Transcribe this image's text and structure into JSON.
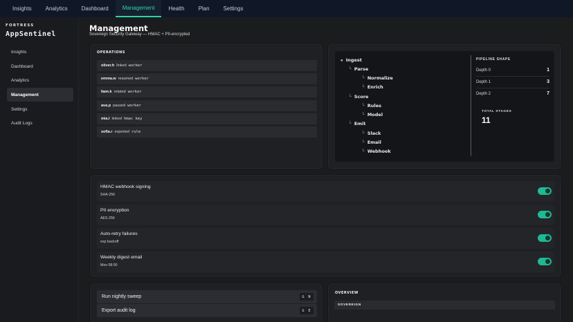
{
  "topnav": {
    "tabs": [
      {
        "label": "Insights"
      },
      {
        "label": "Analytics"
      },
      {
        "label": "Dashboard"
      },
      {
        "label": "Management"
      },
      {
        "label": "Health"
      },
      {
        "label": "Plan"
      },
      {
        "label": "Settings"
      }
    ],
    "active": "Management"
  },
  "sidebar": {
    "brand_kicker": "FORTRESS",
    "brand_name": "AppSentinel",
    "items": [
      {
        "label": "Insights"
      },
      {
        "label": "Dashboard"
      },
      {
        "label": "Analytics"
      },
      {
        "label": "Management"
      },
      {
        "label": "Settings"
      },
      {
        "label": "Audit Logs"
      }
    ],
    "active": "Management"
  },
  "page": {
    "title": "Management",
    "subtitle": "Sovereign Security Gateway — HMAC + PII-encrypted"
  },
  "operations": {
    "heading": "OPERATIONS",
    "rows": [
      {
        "user": "oliver.h",
        "verb": "linked",
        "target": "worker"
      },
      {
        "user": "emma.w",
        "verb": "resumed",
        "target": "worker"
      },
      {
        "user": "liam.k",
        "verb": "rotated",
        "target": "worker"
      },
      {
        "user": "ava.p",
        "verb": "paused",
        "target": "worker"
      },
      {
        "user": "mia.l",
        "verb": "linked",
        "target": "hmac key"
      },
      {
        "user": "sofia.r",
        "verb": "exported",
        "target": "rule"
      }
    ]
  },
  "pipeline": {
    "tree": [
      {
        "label": "Ingest",
        "prefix": "▪ "
      },
      {
        "label": "Parse",
        "prefix": "└ "
      },
      {
        "label": "Normalize",
        "prefix": "└ "
      },
      {
        "label": "Enrich",
        "prefix": "└ "
      },
      {
        "label": "Score",
        "prefix": "└ "
      },
      {
        "label": "Rules",
        "prefix": "└ "
      },
      {
        "label": "Model",
        "prefix": "└ "
      },
      {
        "label": "Emit",
        "prefix": "└ "
      },
      {
        "label": "Slack",
        "prefix": "└ "
      },
      {
        "label": "Email",
        "prefix": "└ "
      },
      {
        "label": "Webhook",
        "prefix": "└ "
      }
    ],
    "shape_title": "PIPELINE SHAPE",
    "depths": [
      {
        "label": "Depth 0",
        "value": "1"
      },
      {
        "label": "Depth 1",
        "value": "3"
      },
      {
        "label": "Depth 2",
        "value": "7"
      }
    ],
    "total_label": "TOTAL STAGES",
    "total_value": "11"
  },
  "settings": [
    {
      "title": "HMAC webhook signing",
      "sub": "SHA-256",
      "enabled": true
    },
    {
      "title": "PII encryption",
      "sub": "AES-256",
      "enabled": true
    },
    {
      "title": "Auto-retry failures",
      "sub": "exp backoff",
      "enabled": true
    },
    {
      "title": "Weekly digest email",
      "sub": "Mon 08:00",
      "enabled": true
    }
  ],
  "actions": [
    {
      "label": "Run nightly sweep",
      "shortcut": "G N"
    },
    {
      "label": "Export audit log",
      "shortcut": "G E"
    }
  ],
  "overview": {
    "heading": "OVERVIEW",
    "row_label": "SOVEREIGN"
  },
  "colors": {
    "accent": "#2fd3a8",
    "toggle_on": "#1fb995",
    "topnav_bg": "#101726"
  }
}
